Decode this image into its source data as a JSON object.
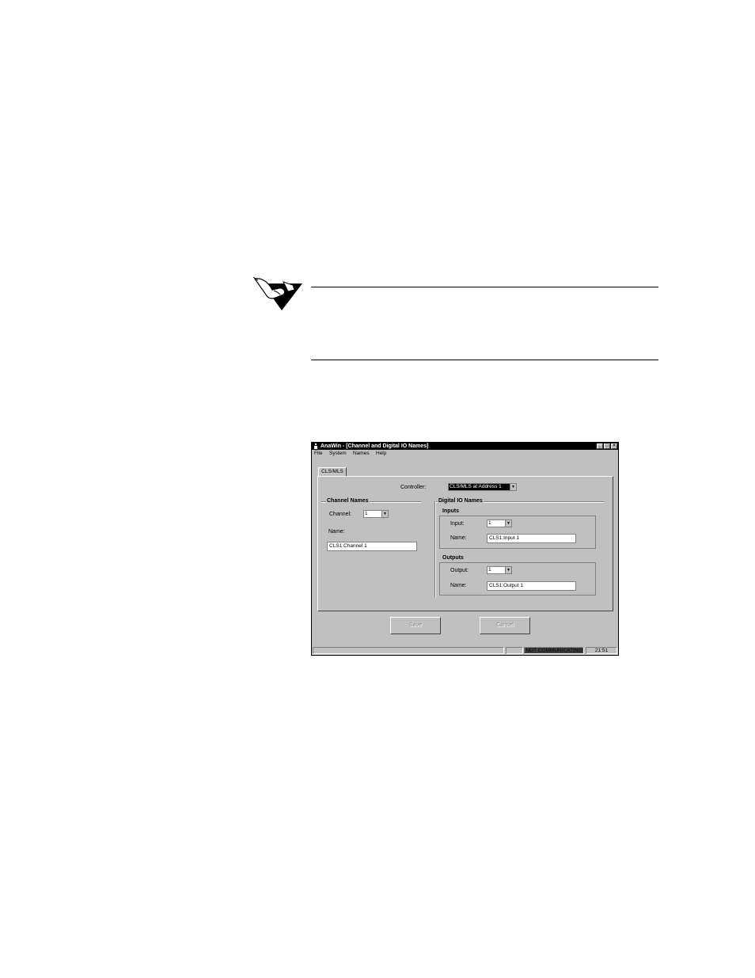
{
  "window": {
    "title": "AnaWin - [Channel and Digital IO Names]",
    "menu": [
      "File",
      "System",
      "Names",
      "Help"
    ],
    "tab_label": "CLS/MLS",
    "controller": {
      "label": "Controller:",
      "value": "CLS/MLS at Address 1"
    },
    "channel_names": {
      "title": "Channel Names",
      "channel_label": "Channel:",
      "channel_value": "1",
      "name_label": "Name:",
      "name_value": "CLS1:Channel 1"
    },
    "digital_io": {
      "title": "Digital IO Names",
      "inputs": {
        "title": "Inputs",
        "input_label": "Input:",
        "input_value": "1",
        "name_label": "Name:",
        "name_value": "CLS1:Input 1"
      },
      "outputs": {
        "title": "Outputs",
        "output_label": "Output:",
        "output_value": "1",
        "name_label": "Name:",
        "name_value": "CLS1:Output 1"
      }
    },
    "buttons": {
      "save": "Save",
      "cancel": "Cancel"
    },
    "status": {
      "connection": "NOT COMMUNICATING",
      "time": "21:51"
    }
  }
}
